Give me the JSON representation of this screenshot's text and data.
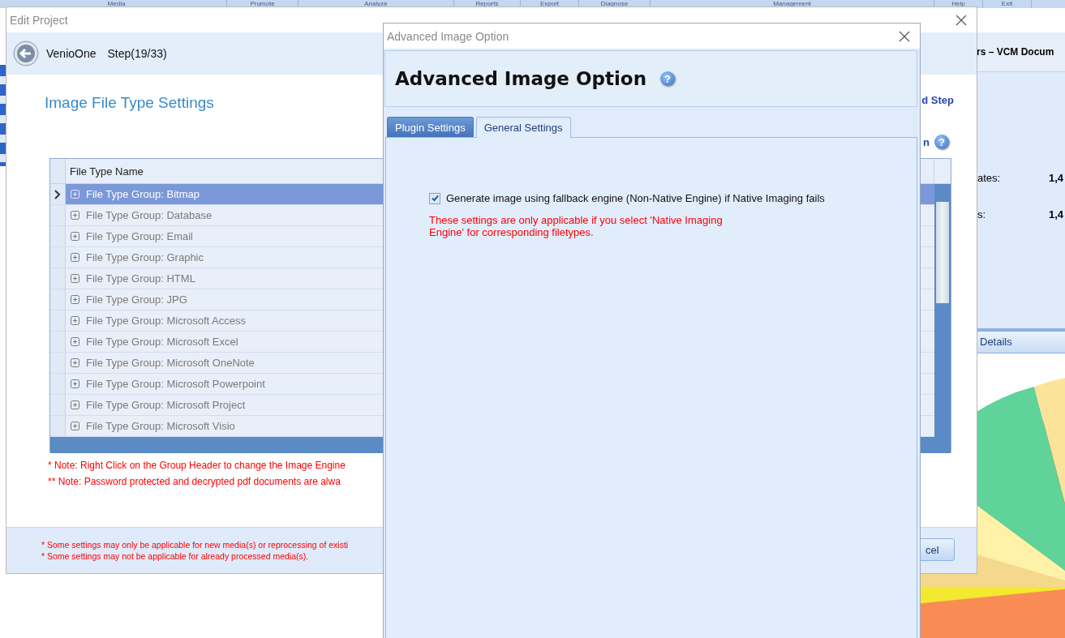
{
  "background_app": {
    "ribbon": [
      {
        "label": "Media"
      },
      {
        "label": "Promote"
      },
      {
        "label": "Analyze"
      },
      {
        "label": "Reports"
      },
      {
        "label": "Export"
      },
      {
        "label": "Diagnose"
      },
      {
        "label": "Management"
      },
      {
        "label": "Help"
      },
      {
        "label": "Exit"
      }
    ],
    "panel_title": "rs – VCM Docum",
    "stats": [
      {
        "label": "ates:",
        "value": "1,4"
      },
      {
        "label": "s:",
        "value": "1,4"
      }
    ],
    "details_header": "Details"
  },
  "edit_project": {
    "title": "Edit Project",
    "app_name": "VenioOne",
    "step": "Step(19/33)",
    "section_title": "Image File Type Settings",
    "next_step_link": "d Step",
    "option_link": "n",
    "option_help": "?",
    "grid": {
      "columns": [
        "File Type Name"
      ],
      "rows": [
        {
          "name": "File Type Group: Bitmap",
          "selected": true
        },
        {
          "name": "File Type Group: Database",
          "selected": false
        },
        {
          "name": "File Type Group: Email",
          "selected": false
        },
        {
          "name": "File Type Group: Graphic",
          "selected": false
        },
        {
          "name": "File Type Group: HTML",
          "selected": false
        },
        {
          "name": "File Type Group: JPG",
          "selected": false
        },
        {
          "name": "File Type Group: Microsoft Access",
          "selected": false
        },
        {
          "name": "File Type Group: Microsoft Excel",
          "selected": false
        },
        {
          "name": "File Type Group: Microsoft OneNote",
          "selected": false
        },
        {
          "name": "File Type Group: Microsoft Powerpoint",
          "selected": false
        },
        {
          "name": "File Type Group: Microsoft Project",
          "selected": false
        },
        {
          "name": "File Type Group: Microsoft Visio",
          "selected": false
        }
      ]
    },
    "notes": [
      "* Note: Right Click on the Group Header to change the Image Engine",
      "** Note: Password protected and decrypted pdf documents are alwa"
    ],
    "footer_notes": [
      "* Some settings may only be applicable for new media(s) or reprocessing of existi",
      "* Some settings may not be applicable for already processed media(s)."
    ],
    "cancel_button": "cel"
  },
  "dialog": {
    "title": "Advanced Image Option",
    "heading": "Advanced Image Option",
    "help": "?",
    "tabs": [
      {
        "label": "Plugin Settings",
        "selected": false
      },
      {
        "label": "General Settings",
        "selected": true
      }
    ],
    "fallback_option": {
      "label": "Generate image using fallback engine (Non-Native Engine) if Native Imaging fails",
      "checked": true
    },
    "info": "These settings are only applicable if you select 'Native Imaging Engine' for corresponding filetypes."
  }
}
